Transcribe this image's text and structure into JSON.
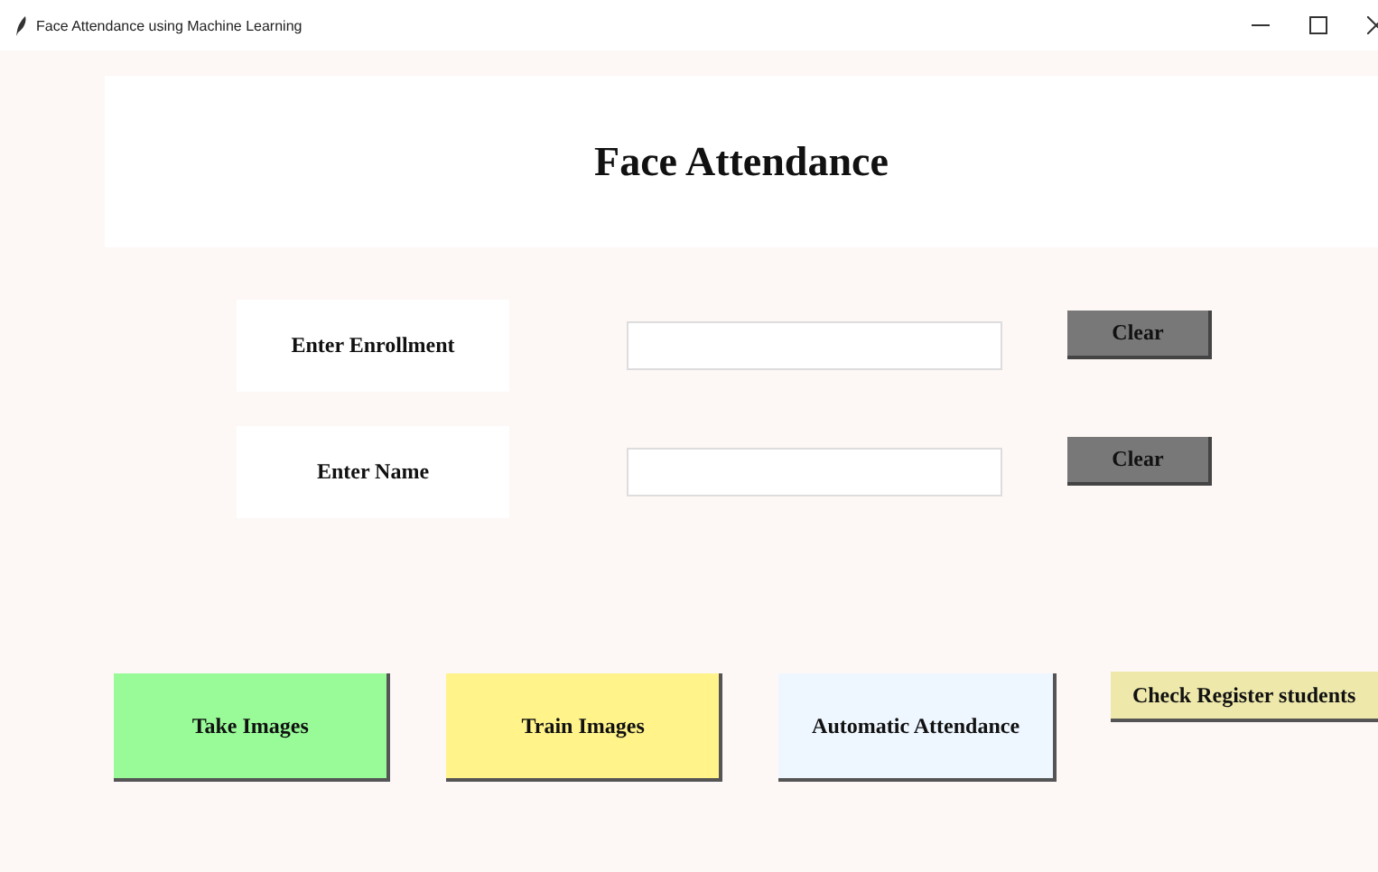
{
  "window": {
    "title": "Face Attendance using Machine Learning"
  },
  "header": {
    "title": "Face Attendance"
  },
  "fields": [
    {
      "label": "Enter Enrollment",
      "button": "Clear"
    },
    {
      "label": "Enter Name",
      "button": "Clear"
    }
  ],
  "actions": [
    {
      "label": "Take Images",
      "color": "#98fb98"
    },
    {
      "label": "Train Images",
      "color": "#fff38a"
    },
    {
      "label": "Automatic Attendance",
      "color": "#eef6ff"
    }
  ],
  "register_button": {
    "label": "Check Register students"
  }
}
